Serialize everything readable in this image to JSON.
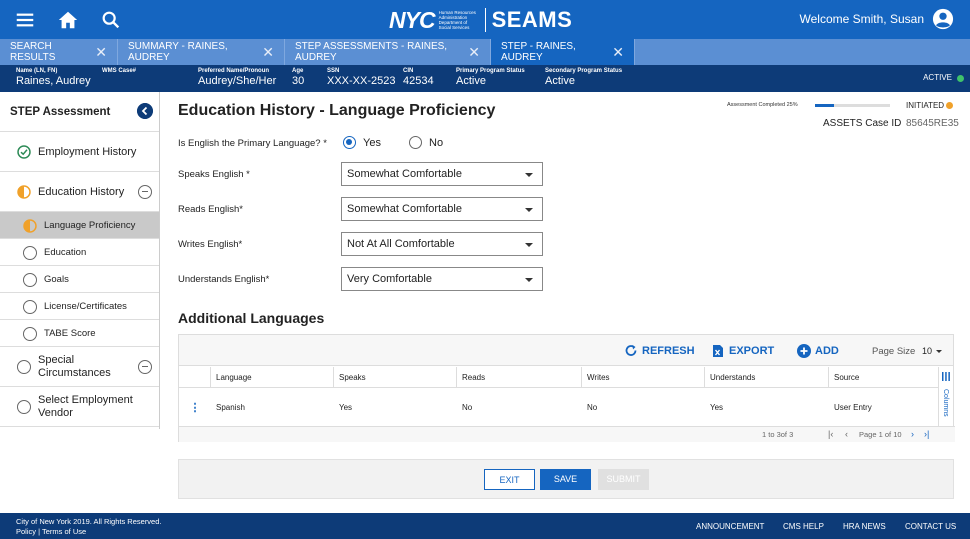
{
  "header": {
    "brand_nyc": "NYC",
    "brand_hra": "Human Resources Administration Department of Social Services",
    "app_name": "SEAMS",
    "welcome": "Welcome Smith, Susan",
    "icons": [
      "menu-icon",
      "home-icon",
      "search-icon",
      "user-account-icon"
    ]
  },
  "tabs": [
    {
      "label": "SEARCH RESULTS"
    },
    {
      "label": "SUMMARY - RAINES, AUDREY"
    },
    {
      "label": "STEP ASSESSMENTS - RAINES, AUDREY"
    },
    {
      "label": "STEP - RAINES, AUDREY"
    }
  ],
  "client": {
    "name_label": "Name (LN, FN)",
    "name": "Raines, Audrey",
    "wms_label": "WMS Case#",
    "wms": "",
    "pronoun_label": "Preferred Name/Pronoun",
    "pronoun": "Audrey/She/Her",
    "age_label": "Age",
    "age": "30",
    "ssn_label": "SSN",
    "ssn": "XXX-XX-2523",
    "cin_label": "CIN",
    "cin": "42534",
    "primary_label": "Primary Program Status",
    "primary": "Active",
    "secondary_label": "Secondary Program Status",
    "secondary": "Active",
    "status": "ACTIVE"
  },
  "sidebar": {
    "title": "STEP Assessment",
    "items": [
      {
        "label": "Employment History"
      },
      {
        "label": "Education History"
      },
      {
        "label": "Language Proficiency"
      },
      {
        "label": "Education"
      },
      {
        "label": "Goals"
      },
      {
        "label": "License/Certificates"
      },
      {
        "label": "TABE Score"
      },
      {
        "label": "Special Circumstances"
      },
      {
        "label": "Select Employment Vendor"
      }
    ]
  },
  "main": {
    "title": "Education History - Language Proficiency",
    "progress_label": "Assessment Completed 25%",
    "progress": 0.25,
    "status": "INITIATED",
    "case_label": "ASSETS Case ID",
    "case_id": "85645RE35",
    "primary_question": "Is English the Primary Language?",
    "yes": "Yes",
    "no": "No",
    "primary_answer": "Yes",
    "questions": [
      {
        "label": "Speaks English",
        "value": "Somewhat Comfortable"
      },
      {
        "label": "Reads English",
        "value": "Somewhat Comfortable"
      },
      {
        "label": "Writes English",
        "value": "Not At All Comfortable"
      },
      {
        "label": "Understands English",
        "value": "Very Comfortable"
      }
    ],
    "additional_title": "Additional Languages"
  },
  "grid": {
    "refresh": "REFRESH",
    "export": "EXPORT",
    "add": "ADD",
    "page_size_label": "Page Size",
    "page_size": "10",
    "columns": [
      "Language",
      "Speaks",
      "Reads",
      "Writes",
      "Understands",
      "Source"
    ],
    "rows": [
      [
        "Spanish",
        "Yes",
        "No",
        "No",
        "Yes",
        "User Entry"
      ]
    ],
    "columns_tool": "Columns",
    "range": "1 to 3of 3",
    "page_info": "Page 1 of 10"
  },
  "actions": {
    "exit": "EXIT",
    "save": "SAVE",
    "submit": "SUBMIT"
  },
  "footer": {
    "copyright": "City of New York 2019. All Rights Reserved.",
    "policy": "Policy | Terms of Use",
    "links": [
      "ANNOUNCEMENT",
      "CMS HELP",
      "HRA NEWS",
      "CONTACT US"
    ]
  },
  "colors": {
    "primary": "#1565c0",
    "dark": "#0d3b78",
    "tab_bg": "#5b8fd3",
    "active": "#3fc26b",
    "initiated": "#f0a12a"
  }
}
